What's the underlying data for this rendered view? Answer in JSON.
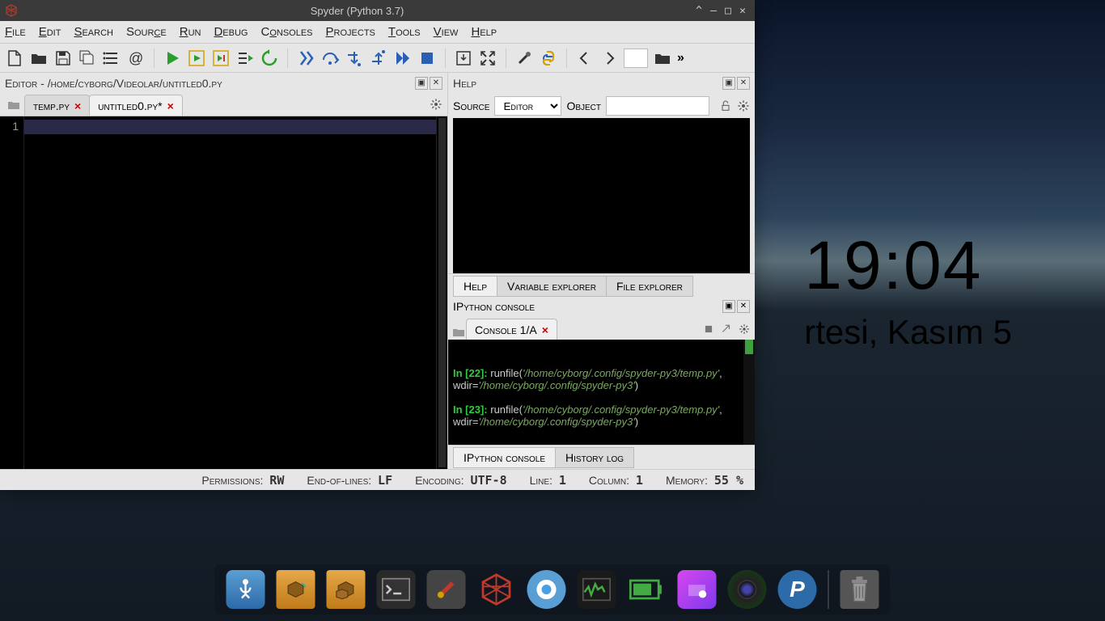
{
  "desktop": {
    "time": "19:04",
    "date": "rtesi, Kasım 5"
  },
  "window": {
    "title": "Spyder (Python 3.7)"
  },
  "menu": [
    "File",
    "Edit",
    "Search",
    "Source",
    "Run",
    "Debug",
    "Consoles",
    "Projects",
    "Tools",
    "View",
    "Help"
  ],
  "editor": {
    "header": "Editor - /home/cyborg/Videolar/untitled0.py",
    "tabs": [
      {
        "label": "temp.py",
        "active": false
      },
      {
        "label": "untitled0.py*",
        "active": true
      }
    ],
    "line_number": "1"
  },
  "help": {
    "header": "Help",
    "source_label": "Source",
    "source_value": "Editor",
    "object_label": "Object",
    "object_value": "",
    "tabs": [
      "Help",
      "Variable explorer",
      "File explorer"
    ]
  },
  "console": {
    "header": "IPython console",
    "tab": "Console 1/A",
    "bottom_tabs": [
      "IPython console",
      "History log"
    ],
    "entries": [
      {
        "n": "22",
        "cmd": "runfile(",
        "arg": "'/home/cyborg/.config/spyder-py3/temp.py'",
        "sep": ", wdir=",
        "wdir": "'/home/cyborg/.config/spyder-py3'",
        "end": ")"
      },
      {
        "n": "23",
        "cmd": "runfile(",
        "arg": "'/home/cyborg/.config/spyder-py3/temp.py'",
        "sep": ", wdir=",
        "wdir": "'/home/cyborg/.config/spyder-py3'",
        "end": ")"
      }
    ]
  },
  "status": {
    "perm_label": "Permissions:",
    "perm": "RW",
    "eol_label": "End-of-lines:",
    "eol": "LF",
    "enc_label": "Encoding:",
    "enc": "UTF-8",
    "line_label": "Line:",
    "line": "1",
    "col_label": "Column:",
    "col": "1",
    "mem_label": "Memory:",
    "mem": "55 %"
  },
  "dock": [
    "anchor",
    "packages",
    "packages2",
    "terminal",
    "tools",
    "spyder",
    "chromium",
    "system-monitor",
    "battery",
    "screenshot",
    "camera",
    "settings",
    "trash"
  ]
}
